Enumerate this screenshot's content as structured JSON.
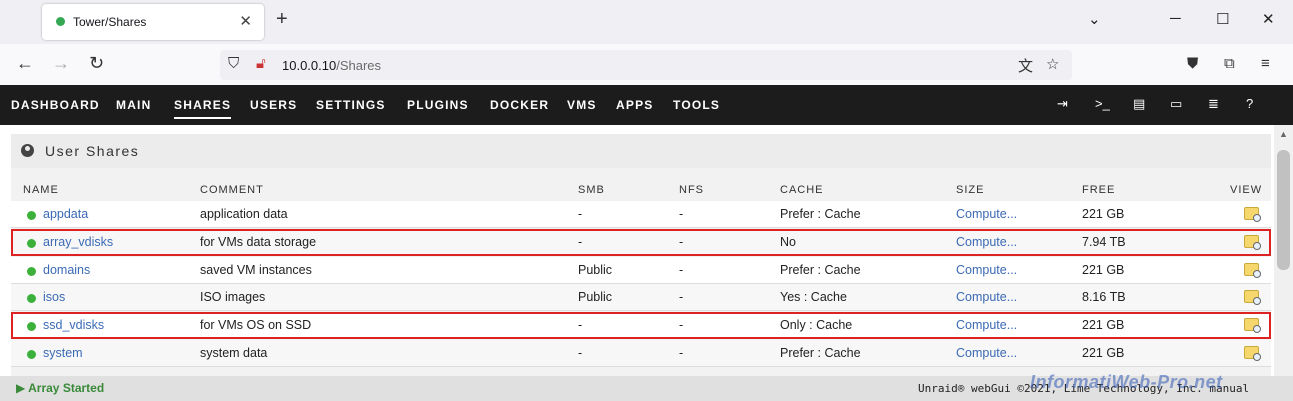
{
  "browser": {
    "tab_title": "Tower/Shares",
    "url_host": "10.0.0.10",
    "url_path": "/Shares"
  },
  "menu": {
    "items": [
      "DASHBOARD",
      "MAIN",
      "SHARES",
      "USERS",
      "SETTINGS",
      "PLUGINS",
      "DOCKER",
      "VMS",
      "APPS",
      "TOOLS"
    ],
    "active": "SHARES"
  },
  "panel": {
    "title": "User Shares"
  },
  "table": {
    "headers": {
      "name": "NAME",
      "comment": "COMMENT",
      "smb": "SMB",
      "nfs": "NFS",
      "cache": "CACHE",
      "size": "SIZE",
      "free": "FREE",
      "view": "VIEW"
    },
    "rows": [
      {
        "name": "appdata",
        "comment": "application data",
        "smb": "-",
        "nfs": "-",
        "cache": "Prefer : Cache",
        "size": "Compute...",
        "free": "221 GB"
      },
      {
        "name": "array_vdisks",
        "comment": "for VMs data storage",
        "smb": "-",
        "nfs": "-",
        "cache": "No",
        "size": "Compute...",
        "free": "7.94 TB"
      },
      {
        "name": "domains",
        "comment": "saved VM instances",
        "smb": "Public",
        "nfs": "-",
        "cache": "Prefer : Cache",
        "size": "Compute...",
        "free": "221 GB"
      },
      {
        "name": "isos",
        "comment": "ISO images",
        "smb": "Public",
        "nfs": "-",
        "cache": "Yes : Cache",
        "size": "Compute...",
        "free": "8.16 TB"
      },
      {
        "name": "ssd_vdisks",
        "comment": "for VMs OS on SSD",
        "smb": "-",
        "nfs": "-",
        "cache": "Only : Cache",
        "size": "Compute...",
        "free": "221 GB"
      },
      {
        "name": "system",
        "comment": "system data",
        "smb": "-",
        "nfs": "-",
        "cache": "Prefer : Cache",
        "size": "Compute...",
        "free": "221 GB"
      }
    ]
  },
  "footer": {
    "status": "Array Started",
    "copyright": "Unraid® webGui ©2021, Lime Technology, Inc. manual"
  },
  "watermark": "InformatiWeb-Pro.net",
  "colors": {
    "menubar": "#1c1c1c",
    "link": "#3b6ab5",
    "status_green": "#3bb13b",
    "highlight_red": "#dd2222"
  }
}
